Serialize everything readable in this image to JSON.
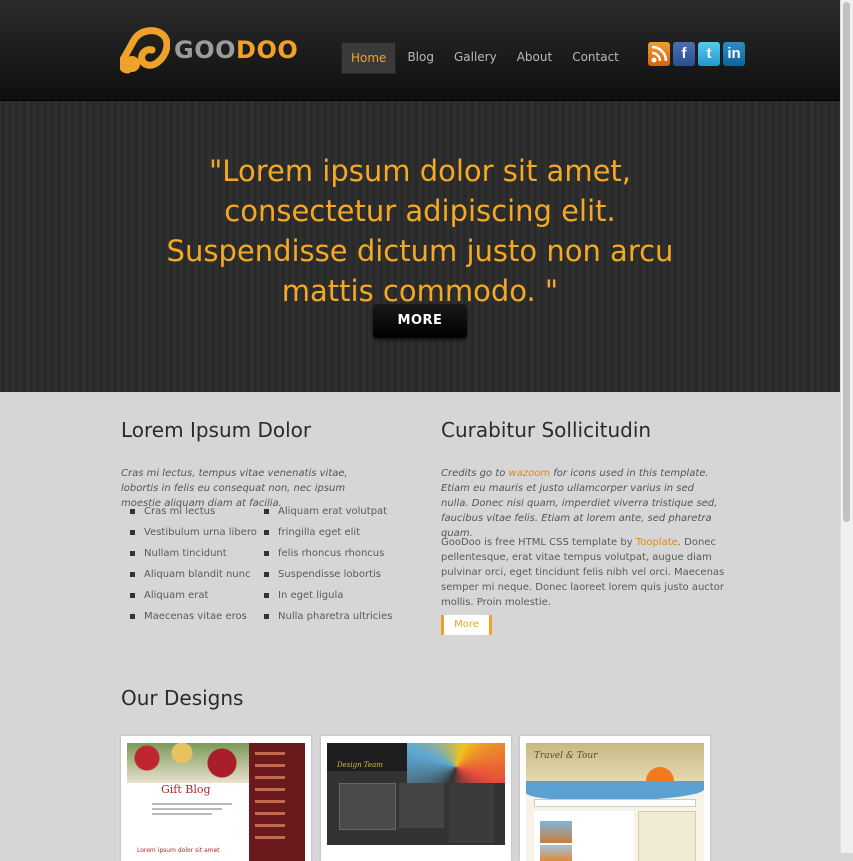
{
  "header": {
    "logo_text_a": "GOO",
    "logo_text_b": "DOO",
    "nav": [
      "Home",
      "Blog",
      "Gallery",
      "About",
      "Contact"
    ],
    "active_nav": "Home",
    "social": [
      "rss-icon",
      "facebook-icon",
      "twitter-icon",
      "linkedin-icon"
    ]
  },
  "banner": {
    "quote": "\"Lorem ipsum dolor sit amet, consectetur adipiscing elit. Suspendisse dictum justo non arcu mattis commodo. \"",
    "more_label": "MORE"
  },
  "left": {
    "title": "Lorem Ipsum Dolor",
    "intro": "Cras mi lectus, tempus vitae venenatis vitae, lobortis in felis eu consequat non, nec ipsum moestie aliquam diam at facilia.",
    "list_a": [
      "Cras mi lectus",
      "Vestibulum urna libero",
      "Nullam tincidunt",
      "Aliquam blandit nunc",
      "Aliquam erat",
      "Maecenas vitae eros"
    ],
    "list_b": [
      "Aliquam erat volutpat",
      "fringilla eget elit",
      "felis rhoncus rhoncus",
      "Suspendisse lobortis",
      "In eget ligula",
      "Nulla pharetra ultricies"
    ]
  },
  "right": {
    "title": "Curabitur Sollicitudin",
    "credits_pre": "Credits go to ",
    "credits_link": "wazoom",
    "credits_post": " for icons used in this template. Etiam eu mauris et justo ullamcorper varius in sed nulla. Donec nisi quam, imperdiet viverra tristique sed, faucibus vitae felis. Etiam at lorem ante, sed pharetra quam.",
    "desc_pre": "GooDoo is free HTML CSS template by ",
    "desc_link": "Tooplate",
    "desc_post": ". Donec pellentesque, erat vitae tempus volutpat, augue diam pulvinar orci, eget tincidunt felis nibh vel orci. Maecenas semper mi neque. Donec laoreet lorem quis justo auctor mollis. Proin molestie.",
    "more_label": "More"
  },
  "designs": {
    "title": "Our Designs",
    "thumb1_title": "Gift Blog",
    "thumb1_footer": "Lorem ipsum dolor sit amet",
    "thumb2_title": "Design Team",
    "thumb3_title": "Travel & Tour"
  }
}
